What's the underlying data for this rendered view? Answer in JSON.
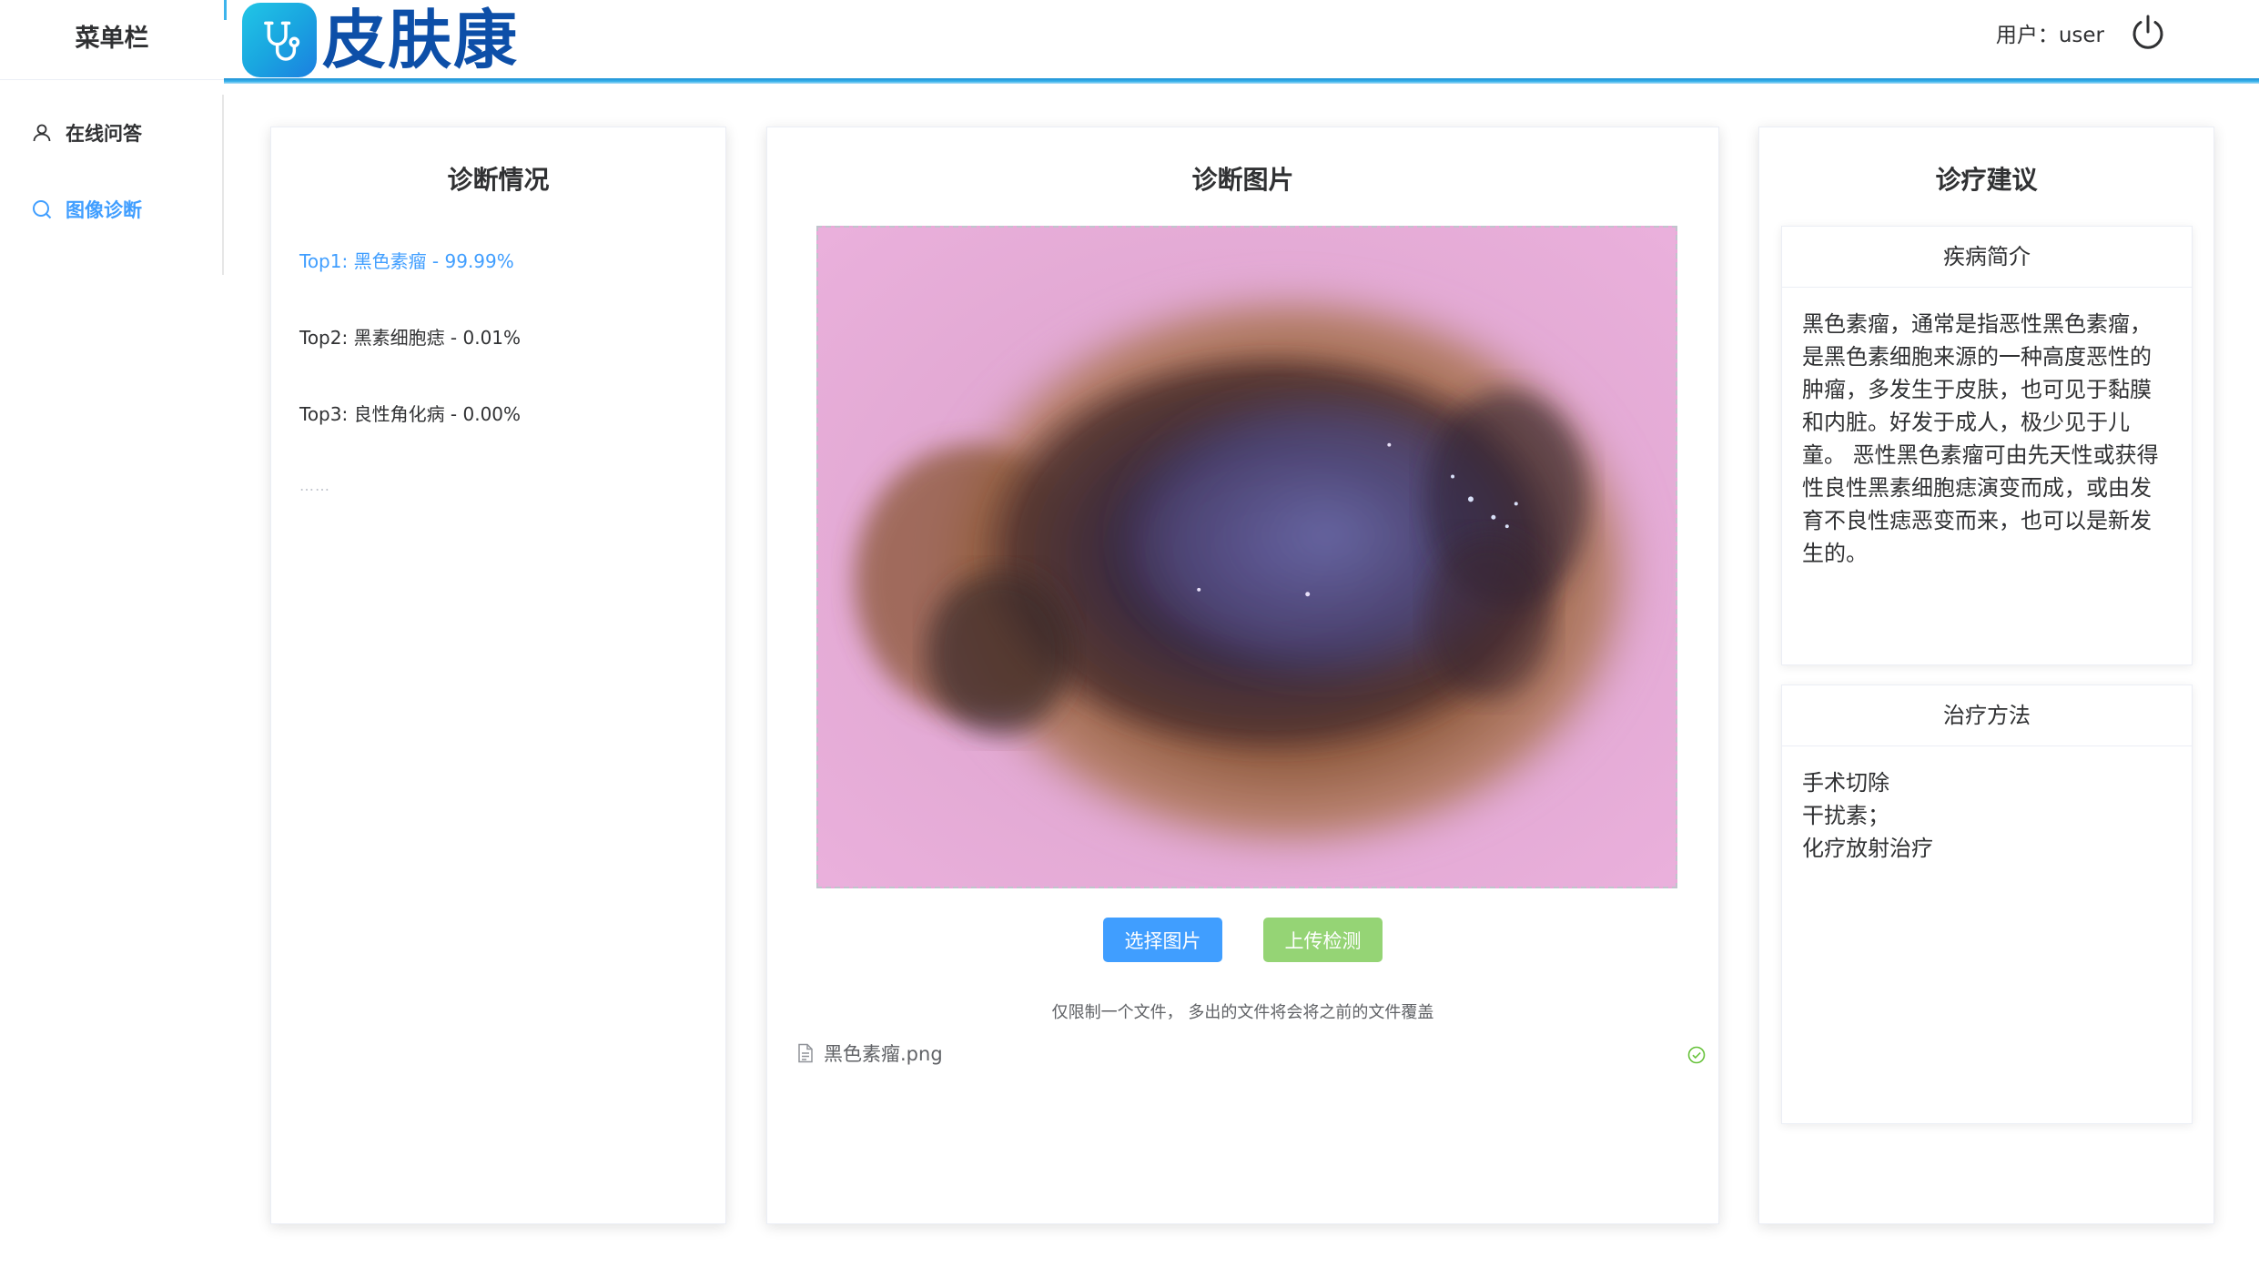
{
  "sidebar": {
    "title": "菜单栏",
    "items": [
      {
        "label": "在线问答",
        "icon": "user-icon",
        "active": false
      },
      {
        "label": "图像诊断",
        "icon": "search-icon",
        "active": true
      }
    ]
  },
  "header": {
    "logo_text": "皮肤康",
    "logo_icon": "stethoscope-icon",
    "user_label": "用户：user",
    "logout_icon": "power-icon"
  },
  "diagnosis": {
    "title": "诊断情况",
    "results": [
      "Top1: 黑色素瘤 - 99.99%",
      "Top2: 黑素细胞痣 - 0.01%",
      "Top3: 良性角化病 - 0.00%"
    ],
    "more": "……"
  },
  "image_panel": {
    "title": "诊断图片",
    "select_button": "选择图片",
    "upload_button": "上传检测",
    "tip": "仅限制一个文件， 多出的文件将会将之前的文件覆盖",
    "file_name": "黑色素瘤.png",
    "file_icon": "document-icon",
    "status_icon": "check-circle-icon"
  },
  "advice": {
    "title": "诊疗建议",
    "intro_header": "疾病简介",
    "intro_text": "黑色素瘤，通常是指恶性黑色素瘤，是黑色素细胞来源的一种高度恶性的肿瘤，多发生于皮肤，也可见于黏膜和内脏。好发于成人，极少见于儿童。 恶性黑色素瘤可由先天性或获得性良性黑素细胞痣演变而成，或由发育不良性痣恶变而来，也可以是新发生的。",
    "treatment_header": "治疗方法",
    "treatment_lines": [
      "手术切除",
      "干扰素；",
      "化疗放射治疗"
    ]
  },
  "colors": {
    "accent": "#409eff",
    "upload_button": "#95d475",
    "logo_text": "#0d4fa8",
    "header_line": "#1a8fd4"
  }
}
